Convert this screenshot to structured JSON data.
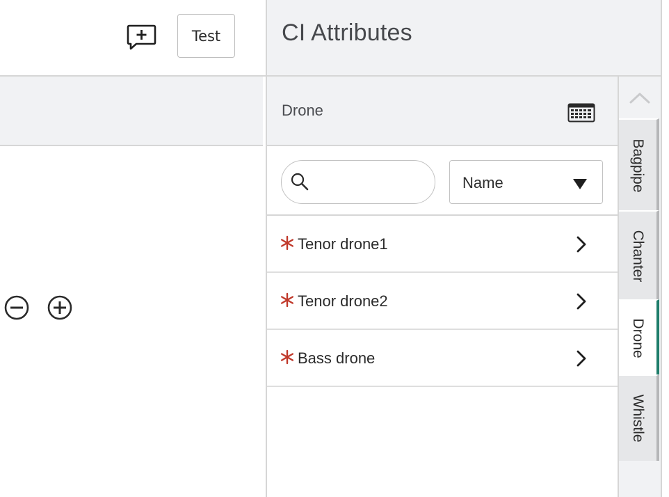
{
  "toolbar": {
    "add_comment_icon": "add-comment-icon",
    "test_label": "Test"
  },
  "canvas": {
    "zoom_out_icon": "zoom-out-icon",
    "zoom_in_icon": "zoom-in-icon"
  },
  "panel": {
    "title": "CI Attributes",
    "section_title": "Drone",
    "table_icon": "keyboard-grid-icon",
    "search": {
      "value": "",
      "placeholder": ""
    },
    "sort": {
      "selected": "Name"
    },
    "items": [
      {
        "label": "Tenor drone1",
        "required": true
      },
      {
        "label": "Tenor drone2",
        "required": true
      },
      {
        "label": "Bass drone",
        "required": true
      }
    ],
    "tabs": [
      {
        "label": "Bagpipe",
        "active": false
      },
      {
        "label": "Chanter",
        "active": false
      },
      {
        "label": "Drone",
        "active": true
      },
      {
        "label": "Whistle",
        "active": false
      }
    ]
  },
  "colors": {
    "accent": "#1e7d6b",
    "required": "#c0392b",
    "header_bg": "#f1f2f4"
  }
}
